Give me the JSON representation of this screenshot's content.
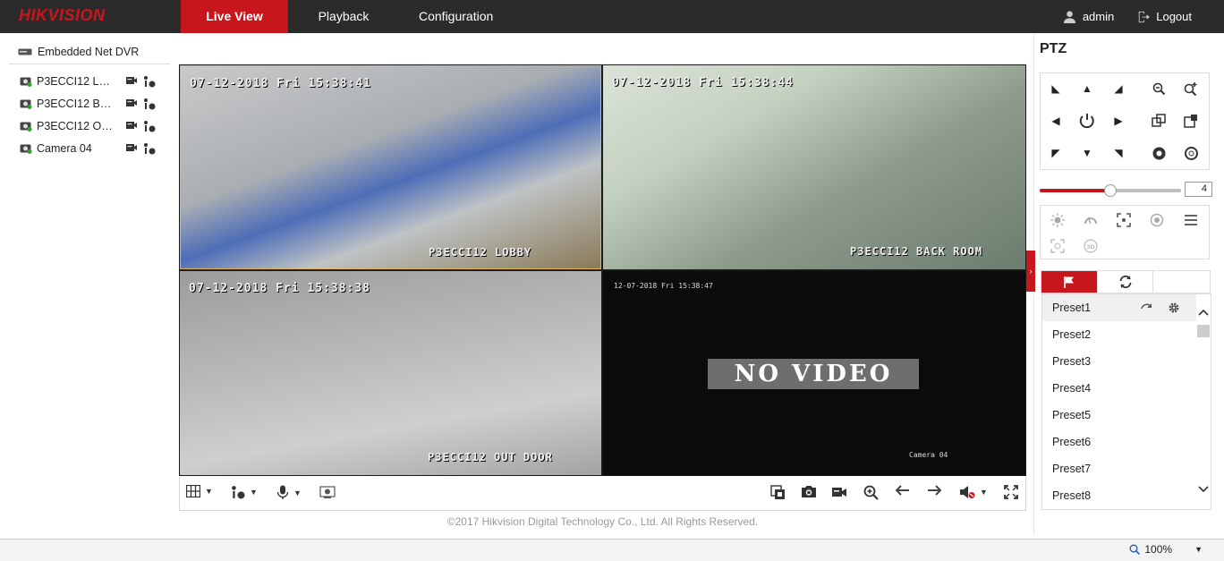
{
  "brand": {
    "logo_text": "HIKVISION",
    "accent": "#c8161d"
  },
  "nav": {
    "live_view": "Live View",
    "playback": "Playback",
    "configuration": "Configuration"
  },
  "user": {
    "name": "admin",
    "logout": "Logout"
  },
  "tree": {
    "root": "Embedded Net DVR",
    "cameras": [
      "P3ECCI12 LO…",
      "P3ECCI12 BA…",
      "P3ECCI12 OU…",
      "Camera 04"
    ]
  },
  "video": {
    "cells": [
      {
        "timestamp": "07-12-2018 Fri 15:38:41",
        "camera": "P3ECCI12 LOBBY"
      },
      {
        "timestamp": "07-12-2018 Fri 15:38:44",
        "camera": "P3ECCI12 BACK ROOM"
      },
      {
        "timestamp": "07-12-2018 Fri 15:38:38",
        "camera": "P3ECCI12 OUT DOOR"
      },
      {
        "timestamp": "12-07-2018 Fri 15:38:47",
        "camera": "Camera 04",
        "no_video": "NO VIDEO"
      }
    ]
  },
  "footer": {
    "copyright": "©2017 Hikvision Digital Technology Co., Ltd. All Rights Reserved."
  },
  "ptz": {
    "title": "PTZ",
    "speed": "4",
    "speed_fraction": 0.5,
    "presets": [
      "Preset1",
      "Preset2",
      "Preset3",
      "Preset4",
      "Preset5",
      "Preset6",
      "Preset7",
      "Preset8"
    ]
  },
  "status": {
    "zoom": "100%"
  }
}
